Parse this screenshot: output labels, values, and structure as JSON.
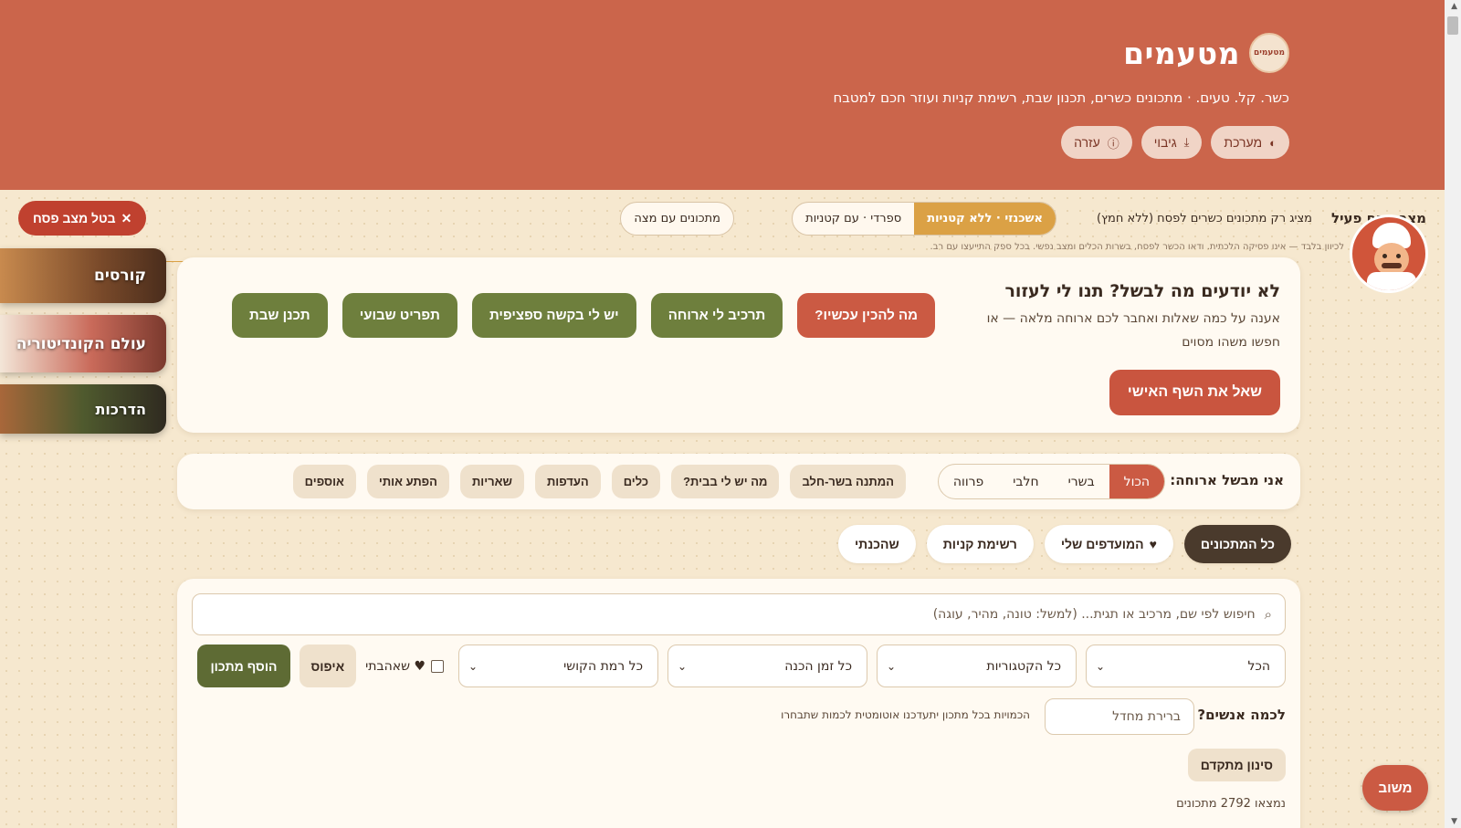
{
  "header": {
    "logo_text": "מטעמים",
    "brand_name": "מטעמים",
    "tagline": "כשר. קל. טעים. · מתכונים כשרים, תכנון שבת, רשימת קניות ועוזר חכם למטבח",
    "buttons": [
      {
        "label": "מערכת",
        "icon": "contrast-icon"
      },
      {
        "label": "גיבוי",
        "icon": "download-icon"
      },
      {
        "label": "עזרה",
        "icon": "help-icon"
      }
    ]
  },
  "pesach": {
    "title": "מצב פסח פעיל",
    "description": "מציג רק מתכונים כשרים לפסח (ללא חמץ)",
    "segments": [
      "אשכנזי · ללא קטניות",
      "ספרדי · עם קטניות"
    ],
    "active_segment": "אשכנזי · ללא קטניות",
    "matza_label": "מתכונים עם מצה",
    "cancel_label": "בטל מצב פסח",
    "note": "לכיוון בלבד — אינו פסיקה הלכתית. ודאו הכשר לפסח, בשרות הכלים ומצב נפשי. בכל ספק התייעצו עם רב."
  },
  "side_cards": [
    {
      "label": "קורסים"
    },
    {
      "label": "עולם הקונדיטוריה"
    },
    {
      "label": "הדרכות"
    }
  ],
  "help": {
    "title": "לא יודעים מה לבשל? תנו לי לעזור",
    "text": "אענה על כמה שאלות ואחבר לכם ארוחה מלאה — או חפשו משהו מסוים",
    "ask_chef": "שאל את השף האישי",
    "actions": [
      {
        "label": "מה להכין עכשיו?"
      },
      {
        "label": "תרכיב לי ארוחה"
      },
      {
        "label": "יש לי בקשה ספציפית"
      },
      {
        "label": "תפריט שבועי"
      },
      {
        "label": "תכנן שבת"
      }
    ]
  },
  "filters": {
    "label": "אני מבשל ארוחה:",
    "kinds": [
      "הכול",
      "בשרי",
      "חלבי",
      "פרווה"
    ],
    "active_kind": "הכול",
    "chips": [
      "המתנה בשר-חלב",
      "מה יש לי בבית?",
      "כלים",
      "העדפות",
      "שאריות",
      "הפתע אותי",
      "אוספים"
    ]
  },
  "tabs": [
    {
      "label": "כל המתכונים",
      "icon": ""
    },
    {
      "label": "המועדפים שלי",
      "icon": "♥"
    },
    {
      "label": "רשימת קניות",
      "icon": ""
    },
    {
      "label": "שהכנתי",
      "icon": ""
    }
  ],
  "search": {
    "placeholder": "חיפוש לפי שם, מרכיב או תגית... (למשל: טונה, מהיר, עוגה)",
    "selects": [
      "הכל",
      "כל הקטגוריות",
      "כל זמן הכנה",
      "כל רמת הקושי"
    ],
    "favorites_label": "♥ שאהבתי",
    "reset_label": "איפוס",
    "add_label": "הוסף מתכון",
    "people_label": "לכמה אנשים?",
    "people_placeholder": "ברירת מחדל",
    "people_hint": "הכמויות בכל מתכון יתעדכנו אוטומטית לכמות שתבחרו",
    "advanced_label": "סינון מתקדם",
    "found_text": "נמצאו 2792 מתכונים"
  },
  "feedback_label": "משוב",
  "colors": {
    "header": "#cb654b",
    "accent_green": "#6e7f3d",
    "accent_red": "#cb5a43",
    "pesach_active": "#dba145",
    "cream": "#fffaf2"
  }
}
